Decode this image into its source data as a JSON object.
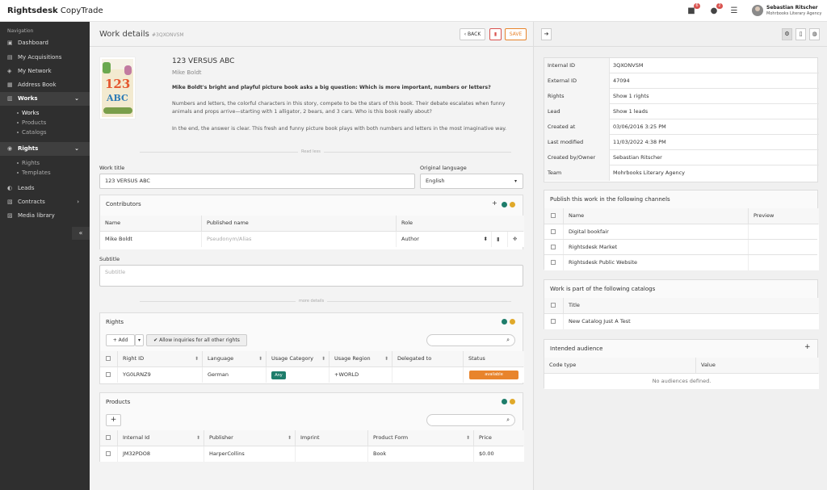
{
  "app": {
    "brand_bold": "Rightsdesk",
    "brand_rest": " CopyTrade"
  },
  "header": {
    "badges": {
      "briefcase": "6",
      "chat": "2"
    },
    "user_name": "Sebastian Ritscher",
    "user_org": "Mohrbooks Literary Agency"
  },
  "sidebar": {
    "heading": "Navigation",
    "items": [
      {
        "label": "Dashboard",
        "icon": "dashboard-icon"
      },
      {
        "label": "My Acquisitions",
        "icon": "acquisitions-icon"
      },
      {
        "label": "My Network",
        "icon": "network-icon"
      },
      {
        "label": "Address Book",
        "icon": "address-book-icon"
      },
      {
        "label": "Works",
        "icon": "works-icon"
      },
      {
        "label": "Rights",
        "icon": "rights-icon"
      },
      {
        "label": "Leads",
        "icon": "leads-icon"
      },
      {
        "label": "Contracts",
        "icon": "contracts-icon"
      },
      {
        "label": "Media library",
        "icon": "media-icon"
      }
    ],
    "works_sub": [
      "Works",
      "Products",
      "Catalogs"
    ],
    "rights_sub": [
      "Rights",
      "Templates"
    ]
  },
  "page": {
    "title": "Work details",
    "id": "#3QXONVSM",
    "back_label": "BACK",
    "save_label": "SAVE"
  },
  "work": {
    "title": "123 VERSUS ABC",
    "author": "Mike Boldt",
    "desc_bold": "Mike Boldt's bright and playful picture book asks a big question: Which is more important, numbers or letters?",
    "desc_p1": "Numbers and letters, the colorful characters in this story, compete to be the stars of this book. Their debate escalates when funny animals and props arrive—starting with 1 alligator, 2 bears, and 3 cars. Who is this book really about?",
    "desc_p2": "In the end, the answer is clear. This fresh and funny picture book plays with both numbers and letters in the most imaginative way.",
    "read_less": "Read less",
    "cover_text": {
      "numbers": "123",
      "letters": "ABC"
    }
  },
  "form": {
    "work_title_label": "Work title",
    "work_title_value": "123 VERSUS ABC",
    "orig_lang_label": "Original language",
    "orig_lang_value": "English",
    "subtitle_label": "Subtitle",
    "subtitle_placeholder": "Subtitle",
    "more_details": "more details"
  },
  "contributors": {
    "title": "Contributors",
    "columns": [
      "Name",
      "Published name",
      "Role"
    ],
    "rows": [
      {
        "name": "Mike Boldt",
        "published_placeholder": "Pseudonym/Alias",
        "role": "Author"
      }
    ]
  },
  "rights": {
    "title": "Rights",
    "add_label": "Add",
    "allow_label": "Allow inquiries for all other rights",
    "columns": [
      "Right ID",
      "Language",
      "Usage Category",
      "Usage Region",
      "Delegated to",
      "Status"
    ],
    "rows": [
      {
        "id": "YG0LRNZ9",
        "language": "German",
        "category": "Any",
        "region": "+WORLD",
        "delegated": "",
        "status": "available"
      }
    ]
  },
  "products": {
    "title": "Products",
    "columns": [
      "Internal Id",
      "Publisher",
      "Imprint",
      "Product Form",
      "Price"
    ],
    "rows": [
      {
        "id": "JM32PDO8",
        "publisher": "HarperCollins",
        "imprint": "",
        "form": "Book",
        "price": "$0.00"
      }
    ]
  },
  "info": [
    {
      "key": "Internal ID",
      "value": "3QXONVSM"
    },
    {
      "key": "External ID",
      "value": "47094"
    },
    {
      "key": "Rights",
      "value": "Show 1 rights"
    },
    {
      "key": "Lead",
      "value": "Show 1 leads"
    },
    {
      "key": "Created at",
      "value": "03/06/2016 3:25 PM"
    },
    {
      "key": "Last modified",
      "value": "11/03/2022 4:38 PM"
    },
    {
      "key": "Created by/Owner",
      "value": "Sebastian Ritscher"
    },
    {
      "key": "Team",
      "value": "Mohrbooks Literary Agency"
    }
  ],
  "channels": {
    "title": "Publish this work in the following channels",
    "columns": [
      "Name",
      "Preview"
    ],
    "rows": [
      "Digital bookfair",
      "Rightsdesk Market",
      "Rightsdesk Public Website"
    ]
  },
  "catalogs": {
    "title": "Work is part of the following catalogs",
    "columns": [
      "Title"
    ],
    "rows": [
      "New Catalog Just A Test"
    ]
  },
  "audience": {
    "title": "Intended audience",
    "columns": [
      "Code type",
      "Value"
    ],
    "empty": "No audiences defined."
  },
  "colors": {
    "status_available": "#e8842c",
    "category_any": "#1e7d6b",
    "delete_red": "#d9534f",
    "save_orange": "#e8842c"
  }
}
